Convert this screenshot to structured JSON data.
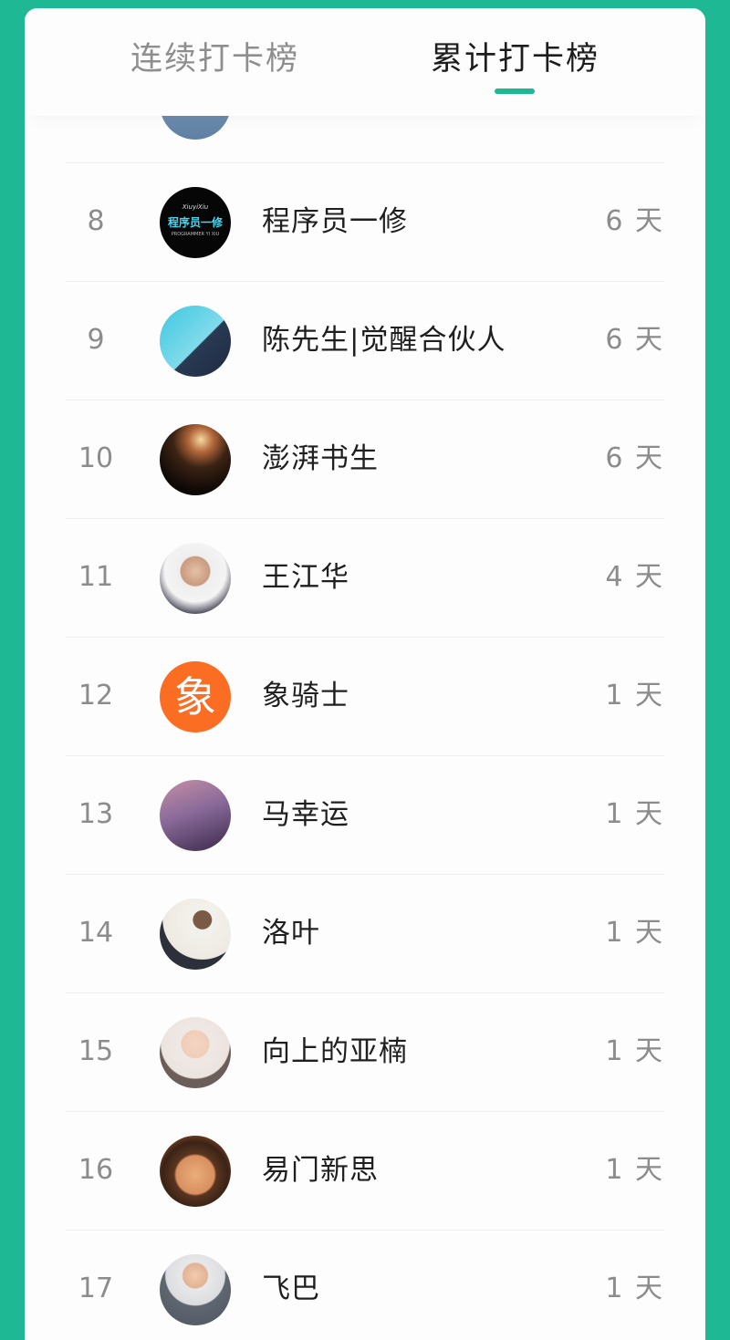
{
  "tabs": {
    "continuous": "连续打卡榜",
    "total": "累计打卡榜",
    "active": "total"
  },
  "accent_color": "#1fb895",
  "rows": [
    {
      "rank": "8",
      "name": "程序员一修",
      "days": "6 天",
      "avatar": "coder-logo-avatar",
      "avatar_text": [
        "XiuyiXiu",
        "程序员一修",
        "PROGRAMMER YI XIU"
      ]
    },
    {
      "rank": "9",
      "name": "陈先生|觉醒合伙人",
      "days": "6 天",
      "avatar": "man-portrait-avatar"
    },
    {
      "rank": "10",
      "name": "澎湃书生",
      "days": "6 天",
      "avatar": "night-light-avatar"
    },
    {
      "rank": "11",
      "name": "王江华",
      "days": "4 天",
      "avatar": "man-selfie-avatar"
    },
    {
      "rank": "12",
      "name": "象骑士",
      "days": "1 天",
      "avatar": "xiang-character-avatar",
      "avatar_text": "象"
    },
    {
      "rank": "13",
      "name": "马幸运",
      "days": "1 天",
      "avatar": "illustration-avatar"
    },
    {
      "rank": "14",
      "name": "洛叶",
      "days": "1 天",
      "avatar": "woman-reading-avatar"
    },
    {
      "rank": "15",
      "name": "向上的亚楠",
      "days": "1 天",
      "avatar": "woman-illustration-avatar"
    },
    {
      "rank": "16",
      "name": "易门新思",
      "days": "1 天",
      "avatar": "cartoon-boy-avatar"
    },
    {
      "rank": "17",
      "name": "飞巴",
      "days": "1 天",
      "avatar": "man-suit-avatar"
    }
  ]
}
